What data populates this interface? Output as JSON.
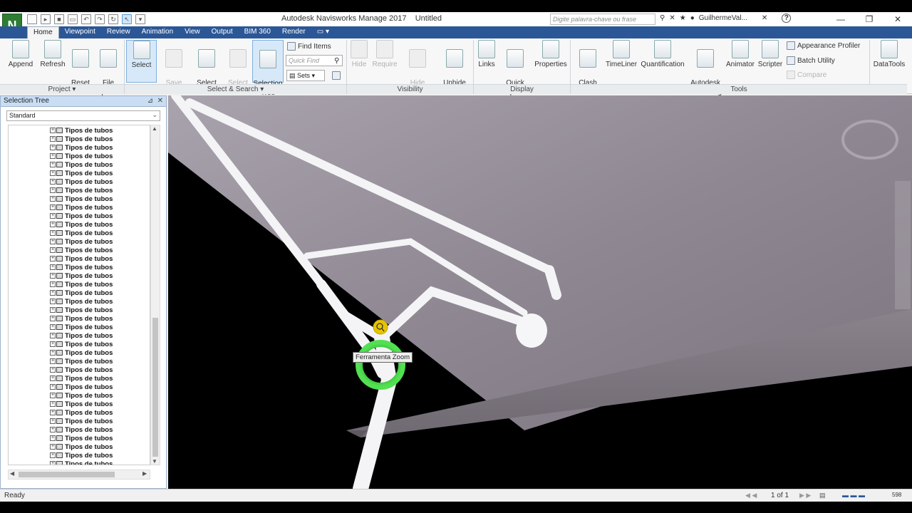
{
  "app": {
    "logo_letter": "N",
    "title": "Autodesk Navisworks Manage 2017",
    "document": "Untitled",
    "search_placeholder": "Digite palavra-chave ou frase",
    "user": "GuilhermeVal...",
    "help": "?"
  },
  "tabs": [
    "Home",
    "Viewpoint",
    "Review",
    "Animation",
    "View",
    "Output",
    "BIM 360",
    "Render"
  ],
  "ribbon": {
    "project": {
      "append": "Append",
      "refresh": "Refresh",
      "reset_all": "Reset\nAll...",
      "file_options": "File\nOptions",
      "label": "Project"
    },
    "select_search": {
      "select": "Select",
      "save_selection": "Save\nSelection",
      "select_all": "Select\nAll",
      "select_same": "Select\nSame",
      "selection_tree": "Selection\nTree",
      "find_items": "Find Items",
      "quick_find_placeholder": "Quick Find",
      "sets": "Sets",
      "label": "Select & Search"
    },
    "visibility": {
      "hide": "Hide",
      "require": "Require",
      "hide_unselected": "Hide\nUnselected",
      "unhide_all": "Unhide\nAll",
      "label": "Visibility"
    },
    "display": {
      "links": "Links",
      "quick_properties": "Quick\nProperties",
      "properties": "Properties",
      "label": "Display"
    },
    "tools": {
      "clash_detective": "Clash\nDetective",
      "timeliner": "TimeLiner",
      "quantification": "Quantification",
      "autodesk_rendering": "Autodesk\nRendering",
      "animator": "Animator",
      "scripter": "Scripter",
      "appearance_profiler": "Appearance Profiler",
      "batch_utility": "Batch Utility",
      "compare": "Compare",
      "label": "Tools"
    },
    "datatools": "DataTools"
  },
  "selection_tree": {
    "title": "Selection Tree",
    "mode": "Standard",
    "item_label": "Tipos de tubos",
    "item_count": 40
  },
  "viewport": {
    "tooltip": "Ferramenta Zoom"
  },
  "status": {
    "text": "Ready",
    "page": "1 of 1",
    "memory": "598"
  }
}
